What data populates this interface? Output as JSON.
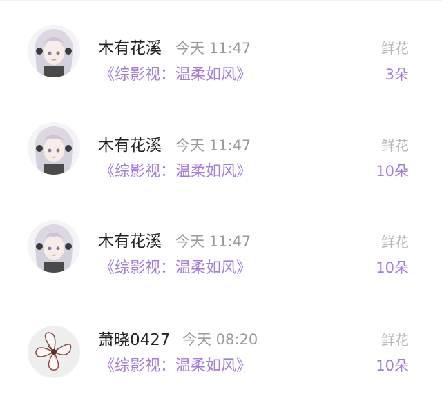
{
  "records": [
    {
      "avatar": "anime-girl-avatar-icon",
      "user_name": "木有花溪",
      "time": "今天 11:47",
      "book_title": "《综影视：温柔如风》",
      "gift_type": "鲜花",
      "gift_count": "3朵"
    },
    {
      "avatar": "anime-girl-avatar-icon",
      "user_name": "木有花溪",
      "time": "今天 11:47",
      "book_title": "《综影视：温柔如风》",
      "gift_type": "鲜花",
      "gift_count": "10朵"
    },
    {
      "avatar": "anime-girl-avatar-icon",
      "user_name": "木有花溪",
      "time": "今天 11:47",
      "book_title": "《综影视：温柔如风》",
      "gift_type": "鲜花",
      "gift_count": "10朵"
    },
    {
      "avatar": "flower-avatar-icon",
      "user_name": "萧晓0427",
      "time": "今天 08:20",
      "book_title": "《综影视：温柔如风》",
      "gift_type": "鲜花",
      "gift_count": "10朵"
    }
  ],
  "colors": {
    "accent": "#a47ed6",
    "name": "#222222",
    "muted": "#9a9a9a",
    "gift_type": "#b8b8b8",
    "divider": "#ececef"
  }
}
